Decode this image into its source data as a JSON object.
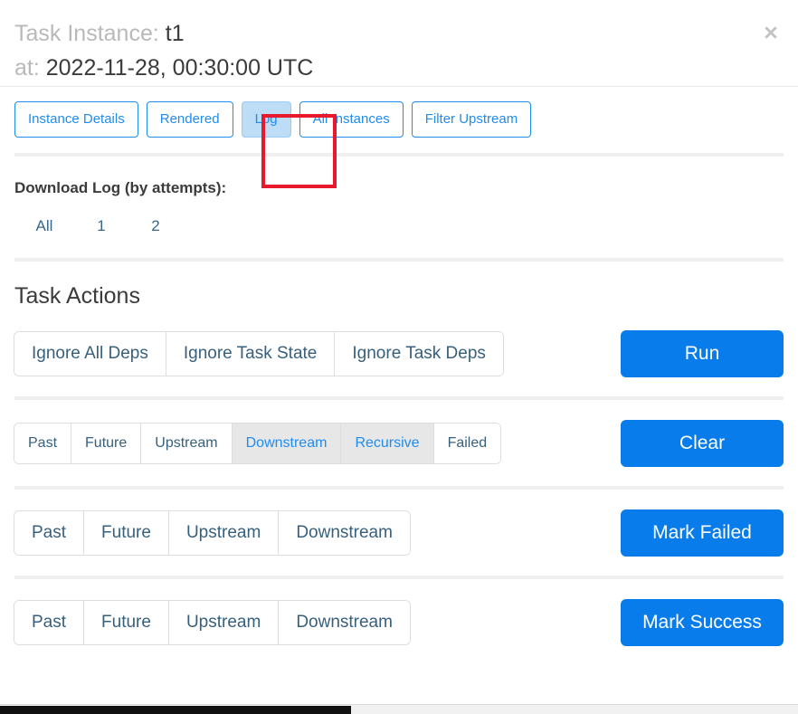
{
  "header": {
    "title_label": "Task Instance:",
    "title_value": "t1",
    "subtitle_label": "at:",
    "subtitle_value": "2022-11-28, 00:30:00 UTC",
    "close_icon": "×"
  },
  "tabs": [
    {
      "label": "Instance Details",
      "active": false
    },
    {
      "label": "Rendered",
      "active": false
    },
    {
      "label": "Log",
      "active": true
    },
    {
      "label": "All Instances",
      "active": false
    },
    {
      "label": "Filter Upstream",
      "active": false
    }
  ],
  "annotation": {
    "target": "Log",
    "color": "#e8192c"
  },
  "download_log": {
    "title": "Download Log (by attempts):",
    "links": [
      "All",
      "1",
      "2"
    ]
  },
  "task_actions": {
    "title": "Task Actions",
    "rows": [
      {
        "name": "run",
        "size": "lg",
        "options": [
          {
            "label": "Ignore All Deps",
            "active": false
          },
          {
            "label": "Ignore Task State",
            "active": false
          },
          {
            "label": "Ignore Task Deps",
            "active": false
          }
        ],
        "action_label": "Run"
      },
      {
        "name": "clear",
        "size": "sm",
        "options": [
          {
            "label": "Past",
            "active": false
          },
          {
            "label": "Future",
            "active": false
          },
          {
            "label": "Upstream",
            "active": false
          },
          {
            "label": "Downstream",
            "active": true
          },
          {
            "label": "Recursive",
            "active": true
          },
          {
            "label": "Failed",
            "active": false
          }
        ],
        "action_label": "Clear"
      },
      {
        "name": "mark-failed",
        "size": "lg",
        "options": [
          {
            "label": "Past",
            "active": false
          },
          {
            "label": "Future",
            "active": false
          },
          {
            "label": "Upstream",
            "active": false
          },
          {
            "label": "Downstream",
            "active": false
          }
        ],
        "action_label": "Mark Failed"
      },
      {
        "name": "mark-success",
        "size": "lg",
        "options": [
          {
            "label": "Past",
            "active": false
          },
          {
            "label": "Future",
            "active": false
          },
          {
            "label": "Upstream",
            "active": false
          },
          {
            "label": "Downstream",
            "active": false
          }
        ],
        "action_label": "Mark Success"
      }
    ]
  },
  "colors": {
    "primary": "#087cea",
    "tab_border": "#1f8cf0",
    "tab_active_bg": "#bddcf5",
    "group_active_bg": "#e7e7e7",
    "link": "#35688c",
    "annotation": "#e8192c"
  }
}
